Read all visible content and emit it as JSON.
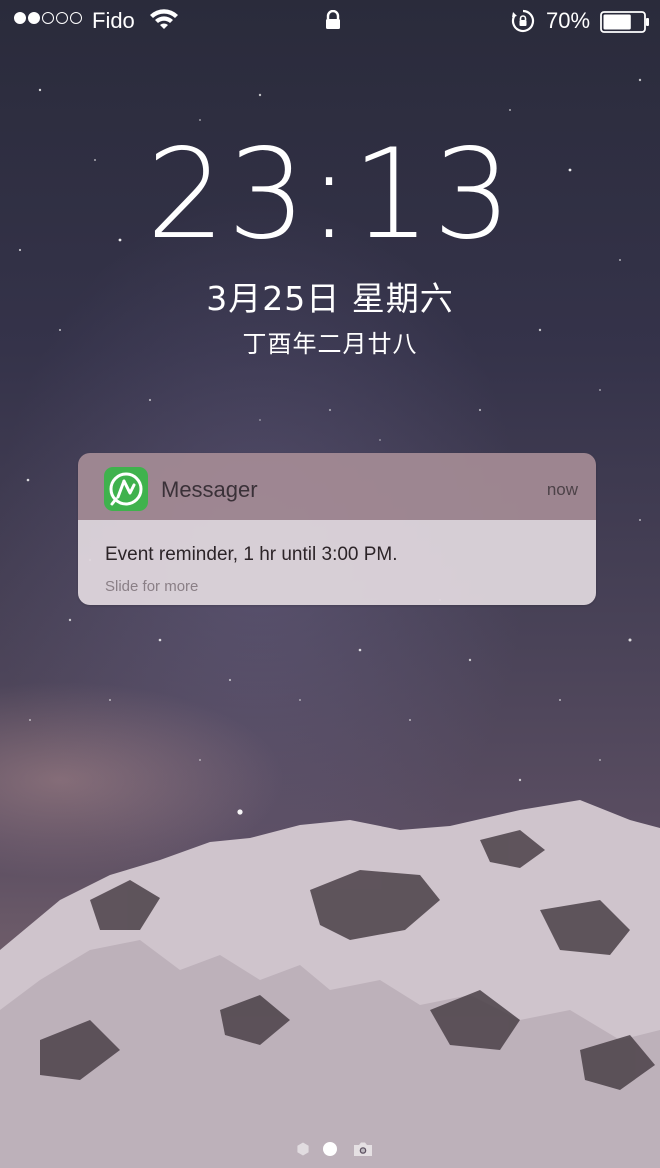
{
  "status_bar": {
    "signal_bars_filled": 2,
    "signal_bars_total": 5,
    "carrier": "Fido",
    "battery_percent_label": "70%",
    "battery_level": 0.7
  },
  "lock_screen": {
    "time": "23:13",
    "date": "3月25日 星期六",
    "lunar_date": "丁酉年二月廿八"
  },
  "notification": {
    "app_name": "Messager",
    "time": "now",
    "message": "Event reminder, 1 hr until 3:00 PM.",
    "hint": "Slide for more",
    "icon_color": "#3fb24d"
  },
  "page_indicator": {
    "pages": [
      "notification-center",
      "lock-screen",
      "camera"
    ],
    "active_index": 1
  }
}
